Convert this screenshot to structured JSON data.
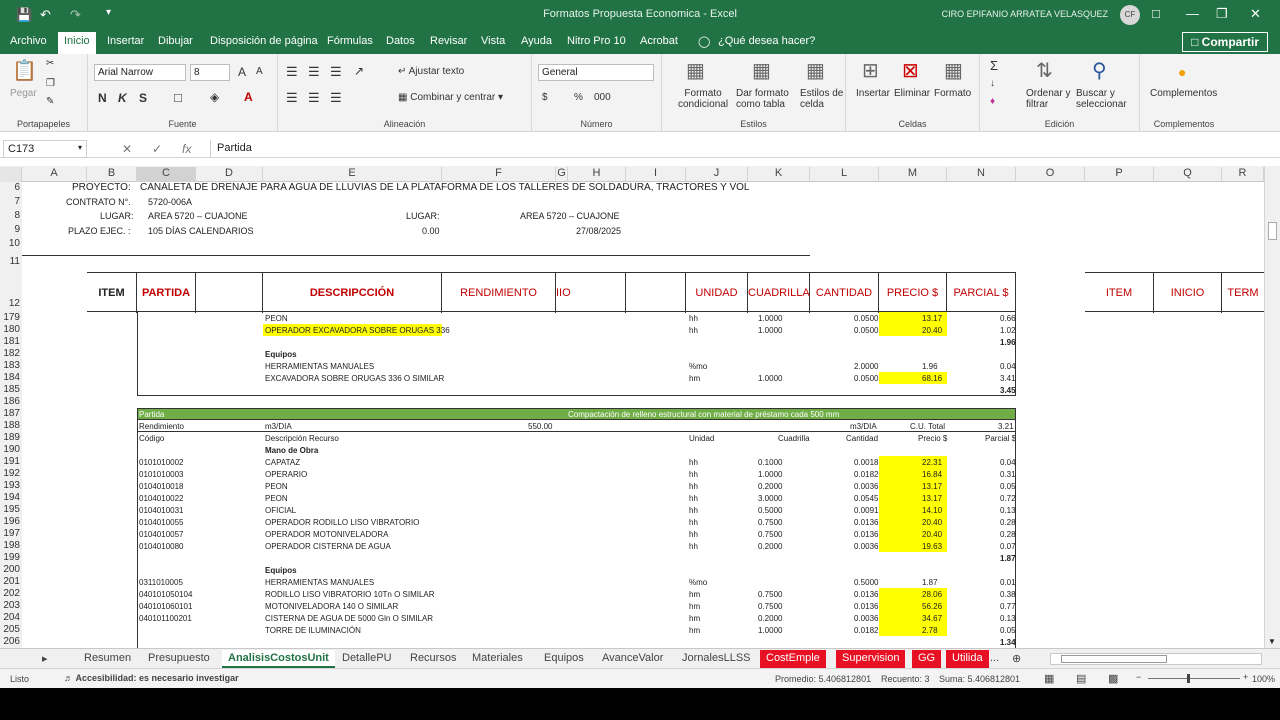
{
  "app": {
    "title": "Formatos Propuesta Economica",
    "sep": "-",
    "app": "Excel",
    "user": "CIRO EPIFANIO ARRATEA VELASQUEZ",
    "avatar": "CF"
  },
  "qa": {
    "save": "save-icon",
    "undo": "undo-icon",
    "redo": "redo-icon"
  },
  "menu": {
    "tabs": [
      "Archivo",
      "Inicio",
      "Insertar",
      "Dibujar",
      "Disposición de página",
      "Fórmulas",
      "Datos",
      "Revisar",
      "Vista",
      "Ayuda",
      "Nitro Pro 10",
      "Acrobat"
    ],
    "tell": "¿Qué desea hacer?",
    "share": "Compartir"
  },
  "ribbon": {
    "portapapeles": {
      "label": "Portapapeles",
      "paste": "Pegar"
    },
    "fuente": {
      "label": "Fuente",
      "font": "Arial Narrow",
      "size": "8",
      "b": "N",
      "i": "K",
      "u": "S"
    },
    "alineacion": {
      "label": "Alineación",
      "wrap": "Ajustar texto",
      "merge": "Combinar y centrar"
    },
    "numero": {
      "label": "Número",
      "format": "General",
      "pct": "%",
      "thousands": "000"
    },
    "estilos": {
      "label": "Estilos",
      "cond1": "Formato",
      "cond2": "condicional",
      "table1": "Dar formato",
      "table2": "como tabla",
      "cell1": "Estilos de",
      "cell2": "celda"
    },
    "celdas": {
      "label": "Celdas",
      "ins": "Insertar",
      "del": "Eliminar",
      "fmt": "Formato"
    },
    "edicion": {
      "label": "Edición",
      "sigma": "Σ",
      "sort1": "Ordenar y",
      "sort2": "filtrar",
      "find1": "Buscar y",
      "find2": "seleccionar"
    },
    "complementos": {
      "label": "Complementos",
      "btn": "Complementos"
    }
  },
  "formula": {
    "name": "C173",
    "value": "Partida",
    "cancel": "✕",
    "enter": "✓",
    "fx": "fx"
  },
  "cols": [
    "A",
    "B",
    "C",
    "D",
    "E",
    "F",
    "G",
    "H",
    "I",
    "J",
    "K",
    "L",
    "M",
    "N",
    "O",
    "P",
    "Q",
    "R"
  ],
  "rows": [
    "6",
    "7",
    "8",
    "9",
    "10",
    "11",
    "12",
    "179",
    "180",
    "181",
    "182",
    "183",
    "184",
    "185",
    "186",
    "187",
    "188",
    "189",
    "190",
    "191",
    "192",
    "193",
    "194",
    "195",
    "196",
    "197",
    "198",
    "199",
    "200",
    "201",
    "202",
    "203",
    "204",
    "205",
    "206"
  ],
  "info": {
    "proyecto_l": "PROYECTO:",
    "proyecto_v": "CANALETA DE DRENAJE PARA AGUA DE LLUVIAS DE LA PLATAFORMA DE LOS TALLERES DE SOLDADURA, TRACTORES Y VOL",
    "contrato_l": "CONTRATO N°.",
    "contrato_v": "5720-006A",
    "lugar_l": "LUGAR:",
    "lugar_v": "AREA 5720 – CUAJONE",
    "lugar2_l": "LUGAR:",
    "lugar2_v": "AREA 5720 – CUAJONE",
    "plazo_l": "PLAZO EJEC. :",
    "plazo_v": "105 DÍAS CALENDARIOS",
    "plazo_n": "0.00",
    "fecha": "27/08/2025"
  },
  "header": {
    "item": "ITEM",
    "partida": "PARTIDA",
    "desc": "DESCRIPCCIÓN",
    "rend": "RENDIMIENTO",
    "inicio_cut": "IIO",
    "unidad": "UNIDAD",
    "cuadrilla": "CUADRILLA",
    "cantidad": "CANTIDAD",
    "precio": "PRECIO $",
    "parcial": "PARCIAL $",
    "item2": "ITEM",
    "inicio2": "INICIO",
    "term": "TERM"
  },
  "block1": [
    {
      "d": "PEON",
      "u": "hh",
      "c": "1.0000",
      "q": "0.0500",
      "p": "13.17",
      "par": "0.66",
      "hl": true
    },
    {
      "d": "OPERADOR EXCAVADORA SOBRE ORUGAS 336",
      "u": "hh",
      "c": "1.0000",
      "q": "0.0500",
      "p": "20.40",
      "par": "1.02",
      "hl": true,
      "dhl": true
    },
    {
      "d": "",
      "u": "",
      "c": "",
      "q": "",
      "p": "",
      "par": "1.96",
      "bold": true
    },
    {
      "d": "Equipos",
      "bold": true
    },
    {
      "d": "HERRAMIENTAS MANUALES",
      "u": "%mo",
      "c": "",
      "q": "2.0000",
      "p": "1.96",
      "par": "0.04"
    },
    {
      "d": "EXCAVADORA SOBRE ORUGAS 336 O SIMILAR",
      "u": "hm",
      "c": "1.0000",
      "q": "0.0500",
      "p": "68.16",
      "par": "3.41",
      "hl": true
    },
    {
      "d": "",
      "par": "3.45",
      "bold": true
    }
  ],
  "block2": {
    "partida": "Partida",
    "titulo": "Compactación de relleno estructural con material de préstamo cada 500 mm",
    "rend": "Rendimiento",
    "rend_u": "m3/DIA",
    "rend_v": "550.00",
    "cu_u": "m3/DIA",
    "cu_l": "C.U. Total",
    "cu_v": "3.21",
    "hdr": {
      "cod": "Código",
      "desc": "Descripción Recurso",
      "u": "Unidad",
      "c": "Cuadrilla",
      "q": "Cantidad",
      "p": "Precio $",
      "par": "Parcial $"
    },
    "mano": "Mano de Obra",
    "mo": [
      {
        "cod": "0101010002",
        "d": "CAPATAZ",
        "u": "hh",
        "c": "0.1000",
        "q": "0.0018",
        "p": "22.31",
        "par": "0.04"
      },
      {
        "cod": "0101010003",
        "d": "OPERARIO",
        "u": "hh",
        "c": "1.0000",
        "q": "0.0182",
        "p": "16.84",
        "par": "0.31"
      },
      {
        "cod": "0104010018",
        "d": "PEON",
        "u": "hh",
        "c": "0.2000",
        "q": "0.0036",
        "p": "13.17",
        "par": "0.05"
      },
      {
        "cod": "0104010022",
        "d": "PEON",
        "u": "hh",
        "c": "3.0000",
        "q": "0.0545",
        "p": "13.17",
        "par": "0.72"
      },
      {
        "cod": "0104010031",
        "d": "OFICIAL",
        "u": "hh",
        "c": "0.5000",
        "q": "0.0091",
        "p": "14.10",
        "par": "0.13"
      },
      {
        "cod": "0104010055",
        "d": "OPERADOR RODILLO LISO VIBRATORIO",
        "u": "hh",
        "c": "0.7500",
        "q": "0.0136",
        "p": "20.40",
        "par": "0.28"
      },
      {
        "cod": "0104010057",
        "d": "OPERADOR MOTONIVELADORA",
        "u": "hh",
        "c": "0.7500",
        "q": "0.0136",
        "p": "20.40",
        "par": "0.28"
      },
      {
        "cod": "0104010080",
        "d": "OPERADOR CISTERNA DE AGUA",
        "u": "hh",
        "c": "0.2000",
        "q": "0.0036",
        "p": "19.63",
        "par": "0.07"
      }
    ],
    "mo_total": "1.87",
    "equipos": "Equipos",
    "eq": [
      {
        "cod": "0311010005",
        "d": "HERRAMIENTAS MANUALES",
        "u": "%mo",
        "c": "",
        "q": "0.5000",
        "p": "1.87",
        "par": "0.01",
        "hl": false
      },
      {
        "cod": "040101050104",
        "d": "RODILLO LISO VIBRATORIO 10Tn O SIMILAR",
        "u": "hm",
        "c": "0.7500",
        "q": "0.0136",
        "p": "28.06",
        "par": "0.38",
        "hl": true
      },
      {
        "cod": "040101060101",
        "d": "MOTONIVELADORA 140 O SIMILAR",
        "u": "hm",
        "c": "0.7500",
        "q": "0.0136",
        "p": "56.26",
        "par": "0.77",
        "hl": true
      },
      {
        "cod": "040101100201",
        "d": "CISTERNA DE AGUA DE 5000 Gln O SIMILAR",
        "u": "hm",
        "c": "0.2000",
        "q": "0.0036",
        "p": "34.67",
        "par": "0.13",
        "hl": true
      },
      {
        "cod": "",
        "d": "TORRE DE ILUMINACIÓN",
        "u": "hm",
        "c": "1.0000",
        "q": "0.0182",
        "p": "2.78",
        "par": "0.05",
        "hl": true
      }
    ],
    "eq_total": "1.34"
  },
  "sheets": [
    {
      "n": "Resumen",
      "s": ""
    },
    {
      "n": "Presupuesto",
      "s": ""
    },
    {
      "n": "AnalisisCostosUnit",
      "s": "active"
    },
    {
      "n": "DetallePU",
      "s": ""
    },
    {
      "n": "Recursos",
      "s": ""
    },
    {
      "n": "Materiales",
      "s": ""
    },
    {
      "n": "Equipos",
      "s": ""
    },
    {
      "n": "AvanceValor",
      "s": ""
    },
    {
      "n": "JornalesLLSS",
      "s": ""
    },
    {
      "n": "CostEmple",
      "s": "red"
    },
    {
      "n": "Supervision",
      "s": "red"
    },
    {
      "n": "GG",
      "s": "red"
    },
    {
      "n": "Utilida",
      "s": "red"
    }
  ],
  "sheet_more": "...",
  "status": {
    "ready": "Listo",
    "access": "Accesibilidad: es necesario investigar",
    "avg": "Promedio: 5.406812801",
    "count": "Recuento: 3",
    "sum": "Suma: 5.406812801",
    "zoom": "100%"
  }
}
